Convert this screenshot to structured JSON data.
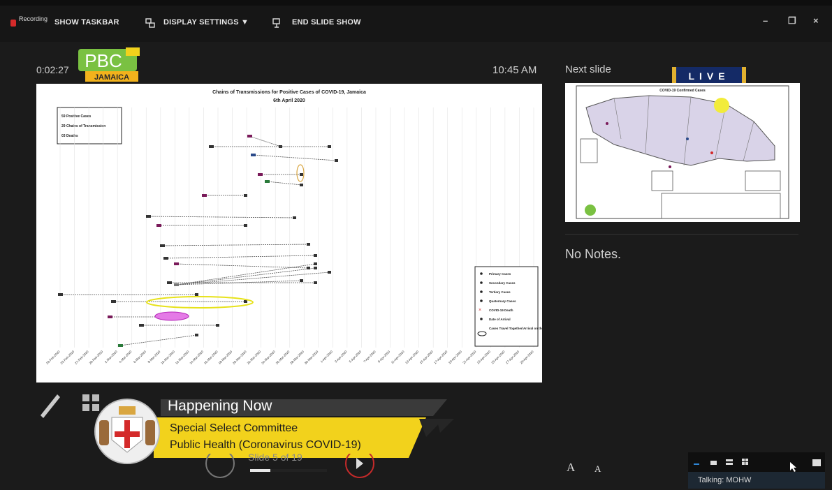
{
  "toolbar": {
    "recording_label": "Recording",
    "show_taskbar": "SHOW TASKBAR",
    "display_settings": "DISPLAY SETTINGS ▼",
    "end_slide_show": "END SLIDE SHOW"
  },
  "window_controls": {
    "minimize": "–",
    "restore": "❐",
    "close": "×"
  },
  "presenter": {
    "elapsed": "0:02:27",
    "clock": "10:45 AM",
    "next_slide_label": "Next slide",
    "notes": "No Notes.",
    "slide_counter": "Slide 5 of 19",
    "progress_fraction": 0.26
  },
  "logo": {
    "top": "PBC",
    "bottom": "JAMAICA"
  },
  "live_badge": "LIVE",
  "slide": {
    "title": "Chains of Transmissions for Positive Cases of COVID-19, Jamaica",
    "subtitle": "6th April 2020",
    "summary": [
      "59 Positive Cases",
      "29 Chains of Transmission",
      "03 Deaths"
    ],
    "legend": [
      "Primary Cases",
      "Secondary Cases",
      "Tertiary Cases",
      "Quaternary Cases",
      "COVID-19 Death",
      "Date of Arrival",
      "Cases Travel Together/Arrival on the Same Flight"
    ],
    "dates": [
      "23-Feb-2020",
      "25-Feb-2020",
      "27-Feb-2020",
      "29-Feb-2020",
      "2-Mar-2020",
      "4-Mar-2020",
      "6-Mar-2020",
      "8-Mar-2020",
      "10-Mar-2020",
      "12-Mar-2020",
      "14-Mar-2020",
      "16-Mar-2020",
      "18-Mar-2020",
      "20-Mar-2020",
      "22-Mar-2020",
      "24-Mar-2020",
      "26-Mar-2020",
      "28-Mar-2020",
      "30-Mar-2020",
      "1-Apr-2020",
      "3-Apr-2020",
      "5-Apr-2020",
      "7-Apr-2020",
      "9-Apr-2020",
      "11-Apr-2020",
      "13-Apr-2020",
      "15-Apr-2020",
      "17-Apr-2020",
      "19-Apr-2020",
      "21-Apr-2020",
      "23-Apr-2020",
      "25-Apr-2020",
      "27-Apr-2020",
      "29-Apr-2020"
    ]
  },
  "next_slide": {
    "title": "COVID-19 Confirmed Cases"
  },
  "lower_third": {
    "title": "Happening Now",
    "line1": "Special Select Committee",
    "line2": "Public Health (Coronavirus COVID-19)"
  },
  "font_buttons": {
    "increase": "A",
    "decrease": "A"
  },
  "participants": {
    "talking": "Talking: MOHW"
  },
  "colors": {
    "accent_yellow": "#f2d21c",
    "live_blue": "#142a66",
    "record_red": "#d42a2a"
  }
}
